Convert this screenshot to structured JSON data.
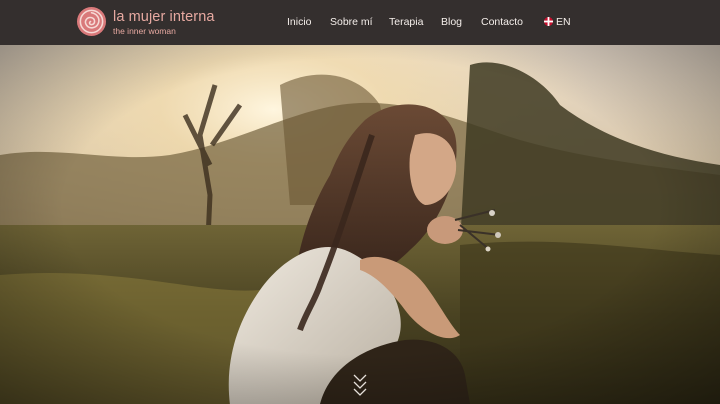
{
  "brand": {
    "title": "la mujer interna",
    "subtitle": "the inner woman",
    "logo_icon": "rose-logo",
    "accent_color": "#e7a9a1"
  },
  "nav": {
    "items": [
      "Inicio",
      "Sobre mí",
      "Terapia",
      "Blog",
      "Contacto"
    ],
    "language": {
      "flag": "uk-flag-icon",
      "label": "EN"
    }
  },
  "hero": {
    "image_alt": "Mujer con los ojos cerrados arrodillada en un prado al atardecer",
    "scroll_icon": "double-chevron-down-icon"
  }
}
